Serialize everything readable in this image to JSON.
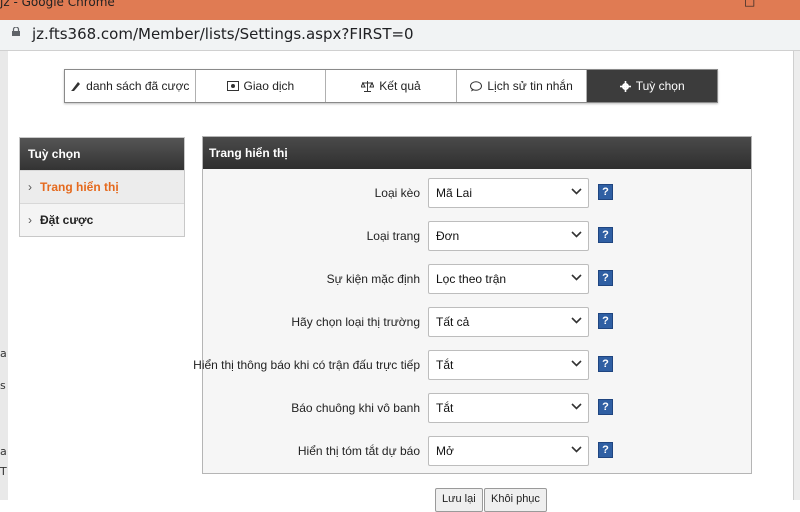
{
  "browser": {
    "window_title": "jz - Google Chrome",
    "url": "jz.fts368.com/Member/lists/Settings.aspx?FIRST=0"
  },
  "left_edge_fragments": [
    "a",
    "s",
    "a",
    "T"
  ],
  "tabs": [
    {
      "label": "danh sách đã cược",
      "icon": "list-icon",
      "active": false
    },
    {
      "label": "Giao dịch",
      "icon": "transaction-icon",
      "active": false
    },
    {
      "label": "Kết quả",
      "icon": "scale-icon",
      "active": false
    },
    {
      "label": "Lịch sử tin nhắn",
      "icon": "chat-icon",
      "active": false
    },
    {
      "label": "Tuỳ chọn",
      "icon": "gear-icon",
      "active": true
    }
  ],
  "sidebar": {
    "title": "Tuỳ chọn",
    "items": [
      {
        "label": "Trang hiển thị",
        "active": true
      },
      {
        "label": "Đặt cược",
        "active": false
      }
    ]
  },
  "panel": {
    "title": "Trang hiển thị",
    "settings": [
      {
        "label": "Loại kèo",
        "value": "Mã Lai"
      },
      {
        "label": "Loại trang",
        "value": "Đơn"
      },
      {
        "label": "Sự kiện mặc định",
        "value": "Lọc theo trận"
      },
      {
        "label": "Hãy chọn loại thị trường",
        "value": "Tất cả"
      },
      {
        "label": "Hiển thị thông báo khi có trận đấu trực tiếp",
        "value": "Tắt"
      },
      {
        "label": "Báo chuông khi vô banh",
        "value": "Tắt"
      },
      {
        "label": "Hiển thị tóm tắt dự báo",
        "value": "Mở"
      }
    ],
    "help_label": "?"
  },
  "footer": {
    "save_label": "Lưu lại",
    "restore_label": "Khôi phục"
  },
  "colors": {
    "titlebar": "#e07b53",
    "active_tab": "#3c3c3c",
    "active_sidebar_text": "#e56a1e",
    "help_button": "#2f5fa3"
  }
}
